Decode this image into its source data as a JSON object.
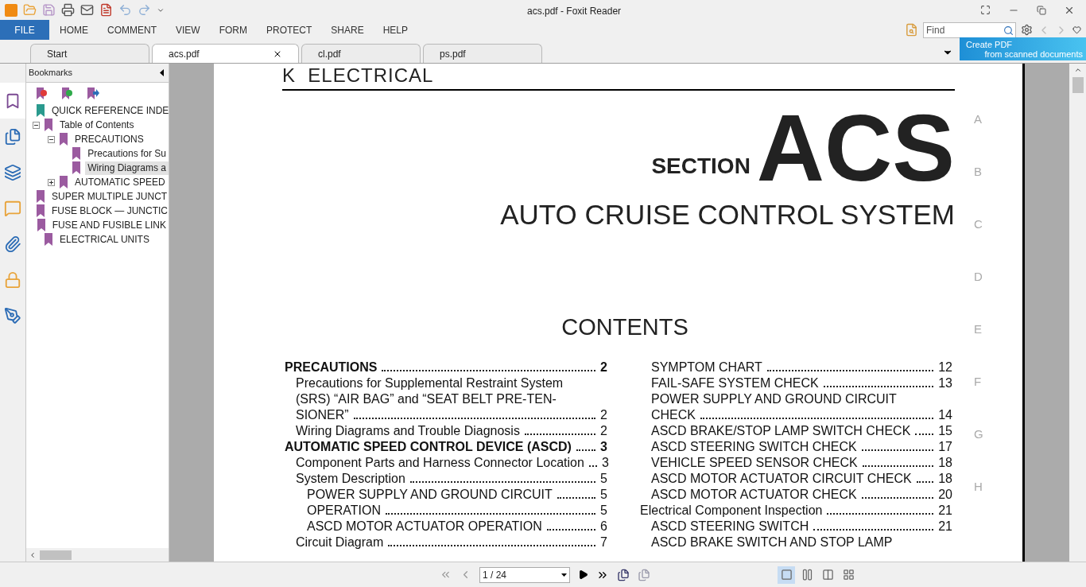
{
  "window": {
    "title": "acs.pdf - Foxit Reader"
  },
  "ribbon_tabs": [
    {
      "label": "FILE",
      "selected": true
    },
    {
      "label": "HOME",
      "selected": false
    },
    {
      "label": "COMMENT",
      "selected": false
    },
    {
      "label": "VIEW",
      "selected": false
    },
    {
      "label": "FORM",
      "selected": false
    },
    {
      "label": "PROTECT",
      "selected": false
    },
    {
      "label": "SHARE",
      "selected": false
    },
    {
      "label": "HELP",
      "selected": false
    }
  ],
  "search": {
    "placeholder": "Find"
  },
  "doc_tabs": [
    {
      "label": "Start",
      "selected": false
    },
    {
      "label": "acs.pdf",
      "selected": true
    },
    {
      "label": "cl.pdf",
      "selected": false
    },
    {
      "label": "ps.pdf",
      "selected": false
    }
  ],
  "banner": {
    "line1": "Create PDF",
    "line2": "from scanned documents"
  },
  "side_icons": [
    {
      "kind": "bookmarks",
      "selected": true
    },
    {
      "kind": "pages",
      "selected": false
    },
    {
      "kind": "layers",
      "selected": false
    },
    {
      "kind": "comments",
      "selected": false
    },
    {
      "kind": "attachments",
      "selected": false
    },
    {
      "kind": "security",
      "selected": false
    },
    {
      "kind": "signatures",
      "selected": false
    }
  ],
  "bookmarks": {
    "title": "Bookmarks",
    "items": [
      {
        "label": "QUICK REFERENCE INDE",
        "color": "#2a9a8e",
        "selected": false
      },
      {
        "label": "Table of Contents",
        "color": "#9b5ba0",
        "selected": false,
        "expanded": true,
        "children": [
          {
            "label": "PRECAUTIONS",
            "color": "#9b5ba0",
            "selected": false,
            "expanded": true,
            "children": [
              {
                "label": "Precautions for Su",
                "color": "#9b5ba0",
                "selected": false
              },
              {
                "label": "Wiring Diagrams a",
                "color": "#9b5ba0",
                "selected": true
              }
            ]
          },
          {
            "label": "AUTOMATIC SPEED",
            "color": "#9b5ba0",
            "selected": false,
            "expanded": false
          }
        ]
      },
      {
        "label": "SUPER MULTIPLE JUNCT",
        "color": "#9b5ba0",
        "selected": false
      },
      {
        "label": "FUSE BLOCK — JUNCTIC",
        "color": "#9b5ba0",
        "selected": false
      },
      {
        "label": "FUSE AND FUSIBLE LINK",
        "color": "#9b5ba0",
        "selected": false
      },
      {
        "label": "ELECTRICAL UNITS",
        "color": "#9b5ba0",
        "selected": false
      }
    ]
  },
  "page": {
    "header": "K  ELECTRICAL",
    "section_label": "SECTION",
    "section_code": "ACS",
    "section_title": "AUTO CRUISE CONTROL SYSTEM",
    "margin_letters": [
      "A",
      "B",
      "C",
      "D",
      "E",
      "F",
      "G",
      "H"
    ],
    "contents_title": "CONTENTS",
    "toc_columns": [
      [
        {
          "kind": "heading",
          "lines": [
            "PRECAUTIONS"
          ],
          "page": "2"
        },
        {
          "kind": "item",
          "lines": [
            "Precautions for Supplemental Restraint System",
            "(SRS) “AIR BAG” and “SEAT BELT PRE-TEN-",
            "SIONER”"
          ],
          "page": "2"
        },
        {
          "kind": "item",
          "lines": [
            "Wiring Diagrams and Trouble Diagnosis"
          ],
          "page": "2"
        },
        {
          "kind": "heading",
          "lines": [
            "AUTOMATIC SPEED CONTROL DEVICE (ASCD)"
          ],
          "page": "3"
        },
        {
          "kind": "item",
          "lines": [
            "Component Parts and Harness Connector Location"
          ],
          "page": "3"
        },
        {
          "kind": "item",
          "lines": [
            "System Description"
          ],
          "page": "5"
        },
        {
          "kind": "subitem",
          "lines": [
            "POWER SUPPLY AND GROUND CIRCUIT"
          ],
          "page": "5"
        },
        {
          "kind": "subitem",
          "lines": [
            "OPERATION"
          ],
          "page": "5"
        },
        {
          "kind": "subitem",
          "lines": [
            "ASCD MOTOR ACTUATOR OPERATION"
          ],
          "page": "6"
        },
        {
          "kind": "item",
          "lines": [
            "Circuit Diagram"
          ],
          "page": "7"
        }
      ],
      [
        {
          "kind": "item",
          "lines": [
            "SYMPTOM CHART"
          ],
          "page": "12"
        },
        {
          "kind": "item",
          "lines": [
            "FAIL-SAFE SYSTEM CHECK"
          ],
          "page": "13"
        },
        {
          "kind": "item",
          "lines": [
            "POWER SUPPLY AND GROUND CIRCUIT",
            "CHECK"
          ],
          "page": "14"
        },
        {
          "kind": "item",
          "lines": [
            "ASCD BRAKE/STOP LAMP SWITCH CHECK"
          ],
          "page": "15"
        },
        {
          "kind": "item",
          "lines": [
            "ASCD STEERING SWITCH CHECK"
          ],
          "page": "17"
        },
        {
          "kind": "item",
          "lines": [
            "VEHICLE SPEED SENSOR CHECK"
          ],
          "page": "18"
        },
        {
          "kind": "item",
          "lines": [
            "ASCD MOTOR ACTUATOR CIRCUIT CHECK"
          ],
          "page": "18"
        },
        {
          "kind": "item",
          "lines": [
            "ASCD MOTOR ACTUATOR CHECK"
          ],
          "page": "20"
        },
        {
          "kind": "plain",
          "lines": [
            "Electrical Component Inspection"
          ],
          "page": "21"
        },
        {
          "kind": "item",
          "lines": [
            "ASCD STEERING SWITCH"
          ],
          "page": "21"
        },
        {
          "kind": "item",
          "lines": [
            "ASCD BRAKE SWITCH AND STOP LAMP"
          ]
        }
      ]
    ]
  },
  "navigation": {
    "page_field": "1 / 24"
  },
  "view_modes": [
    {
      "kind": "single",
      "selected": true
    },
    {
      "kind": "continuous",
      "selected": false
    },
    {
      "kind": "facing",
      "selected": false
    },
    {
      "kind": "continuous-facing",
      "selected": false
    }
  ]
}
